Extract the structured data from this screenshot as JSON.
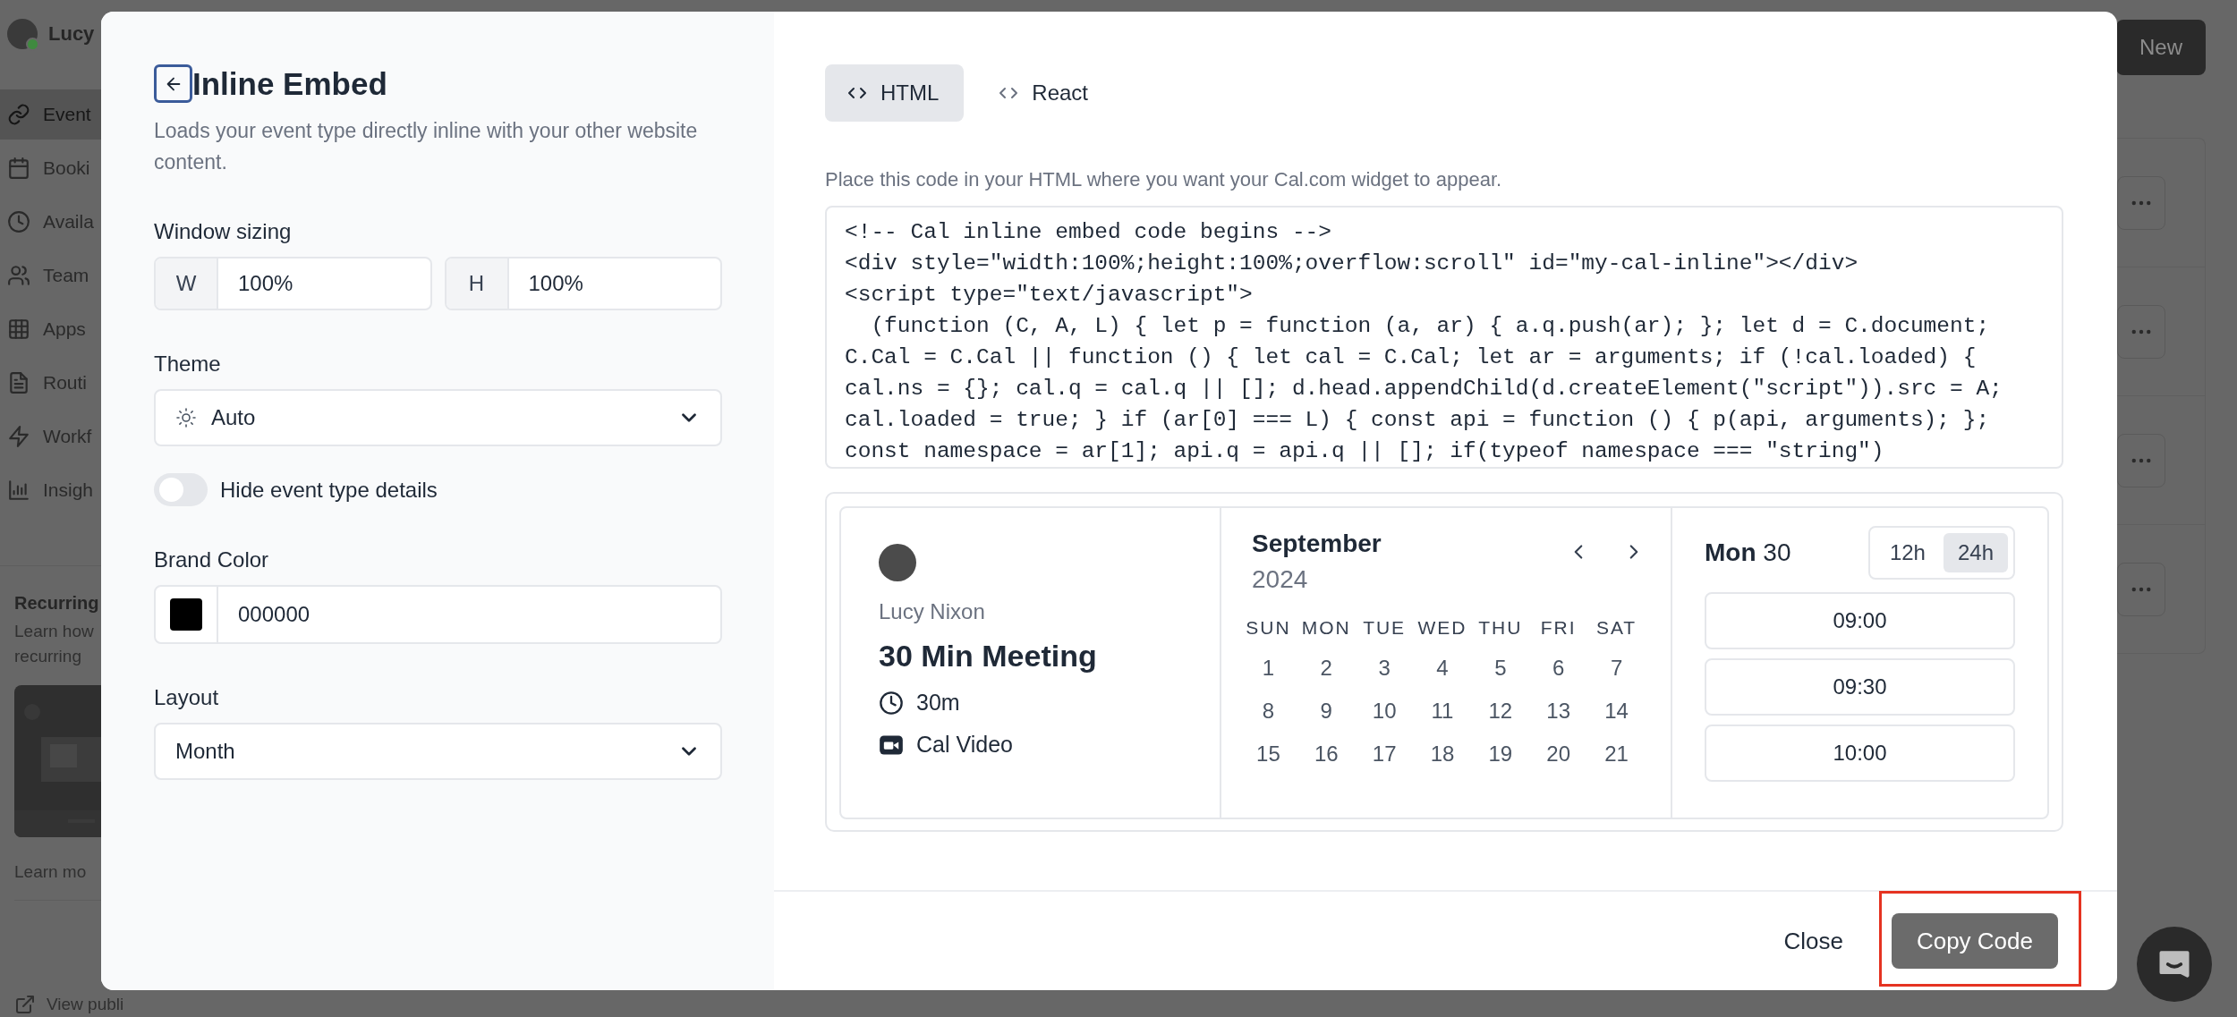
{
  "background": {
    "user": {
      "name": "Lucy",
      "online": true
    },
    "nav": [
      {
        "label": "Event",
        "selected": true
      },
      {
        "label": "Booki",
        "selected": false
      },
      {
        "label": "Availa",
        "selected": false
      },
      {
        "label": "Team",
        "selected": false
      },
      {
        "label": "Apps",
        "selected": false
      },
      {
        "label": "Routi",
        "selected": false
      },
      {
        "label": "Workf",
        "selected": false
      },
      {
        "label": "Insigh",
        "selected": false
      }
    ],
    "promo": {
      "title": "Recurring",
      "text": [
        "Learn how",
        "recurring"
      ],
      "link": "Learn mo"
    },
    "view_public": "View publi",
    "new_button": "New"
  },
  "modal": {
    "title": "Inline Embed",
    "description": "Loads your event type directly inline with your other website content.",
    "sizing": {
      "label": "Window sizing",
      "fields": [
        {
          "prefix": "W",
          "value": "100%"
        },
        {
          "prefix": "H",
          "value": "100%"
        }
      ]
    },
    "theme": {
      "label": "Theme",
      "value": "Auto"
    },
    "hide_details": {
      "label": "Hide event type details",
      "on": false
    },
    "brand_color": {
      "label": "Brand Color",
      "color": "#000000",
      "value": "000000"
    },
    "layout": {
      "label": "Layout",
      "value": "Month"
    },
    "tabs": [
      {
        "label": "HTML",
        "selected": true
      },
      {
        "label": "React",
        "selected": false
      }
    ],
    "hint": "Place this code in your HTML where you want your Cal.com widget to appear.",
    "code": [
      "<!-- Cal inline embed code begins -->",
      "<div style=\"width:100%;height:100%;overflow:scroll\" id=\"my-cal-inline\"></div>",
      "<script type=\"text/javascript\">",
      "  (function (C, A, L) { let p = function (a, ar) { a.q.push(ar); }; let d = C.document;",
      "C.Cal = C.Cal || function () { let cal = C.Cal; let ar = arguments; if (!cal.loaded) {",
      "cal.ns = {}; cal.q = cal.q || []; d.head.appendChild(d.createElement(\"script\")).src = A;",
      "cal.loaded = true; } if (ar[0] === L) { const api = function () { p(api, arguments); };",
      "const namespace = ar[1]; api.q = api.q || []; if(typeof namespace === \"string\")"
    ],
    "preview": {
      "name": "Lucy Nixon",
      "event": "30 Min Meeting",
      "duration": "30m",
      "location": "Cal Video",
      "month": "September",
      "year": "2024",
      "weekdays": [
        "SUN",
        "MON",
        "TUE",
        "WED",
        "THU",
        "FRI",
        "SAT"
      ],
      "days": [
        [
          "1",
          "2",
          "3",
          "4",
          "5",
          "6",
          "7"
        ],
        [
          "8",
          "9",
          "10",
          "11",
          "12",
          "13",
          "14"
        ],
        [
          "15",
          "16",
          "17",
          "18",
          "19",
          "20",
          "21"
        ]
      ],
      "date_day": "Mon",
      "date_num": "30",
      "formats": [
        {
          "label": "12h",
          "selected": false
        },
        {
          "label": "24h",
          "selected": true
        }
      ],
      "slots": [
        "09:00",
        "09:30",
        "10:00"
      ]
    },
    "close": "Close",
    "copy": "Copy Code",
    "copy_highlighted": true
  }
}
